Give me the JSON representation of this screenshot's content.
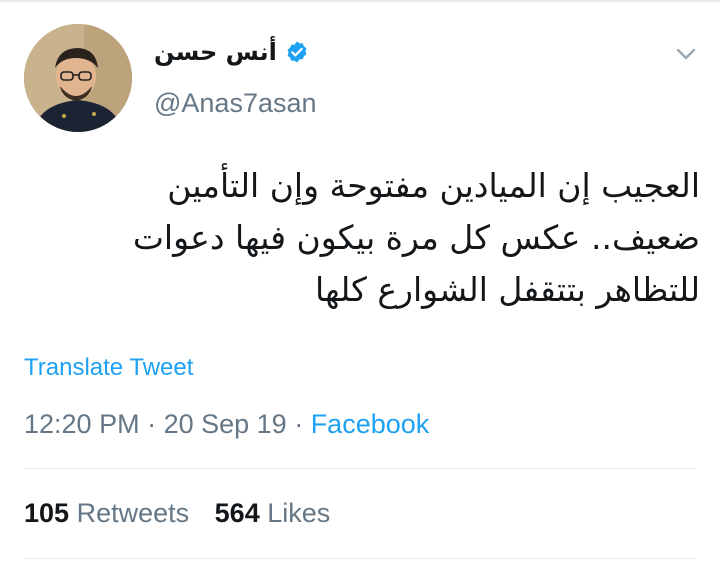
{
  "tweet": {
    "author_name": "أنس حسن",
    "handle": "@Anas7asan",
    "verified": true,
    "text_lines": [
      "العجيب إن الميادين مفتوحة وإن التأمين",
      "ضعيف.. عكس كل مرة بيكون فيها دعوات",
      "للتظاهر بتتقفل الشوارع كلها"
    ],
    "translate_label": "Translate Tweet",
    "time": "12:20 PM",
    "separator": " · ",
    "date": "20 Sep 19",
    "source": "Facebook",
    "retweets_count": "105",
    "retweets_label": "Retweets",
    "likes_count": "564",
    "likes_label": "Likes"
  },
  "icons": {
    "verified": "verified-badge-icon",
    "menu": "chevron-down-icon"
  },
  "colors": {
    "link": "#1da1f2",
    "text": "#14171a",
    "secondary": "#657786",
    "divider": "#e6ecf0"
  }
}
